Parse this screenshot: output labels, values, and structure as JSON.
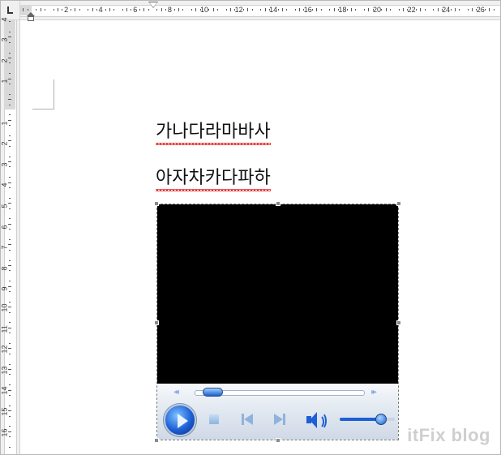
{
  "ruler": {
    "horizontal_numbers": [
      "2",
      "4",
      "6",
      "8",
      "10",
      "12",
      "14",
      "16",
      "18",
      "20",
      "22",
      "24",
      "26"
    ],
    "vertical_numbers_top": [
      "4",
      "3",
      "2",
      "1"
    ],
    "vertical_numbers": [
      "1",
      "2",
      "3",
      "4",
      "5",
      "6",
      "7",
      "8",
      "9",
      "10",
      "11",
      "12",
      "13",
      "14",
      "15",
      "16"
    ]
  },
  "document": {
    "paragraphs": [
      "가나다라마바사",
      "아자차카다파하"
    ]
  },
  "media_player": {
    "seek_back_symbol": "◂◂",
    "seek_forward_symbol": "▸▸",
    "seek_position": 0.05,
    "volume_level": 0.75,
    "colors": {
      "accent": "#1d5fd6",
      "video_bg": "#000000"
    }
  },
  "watermark": {
    "text": "itFix blog"
  }
}
